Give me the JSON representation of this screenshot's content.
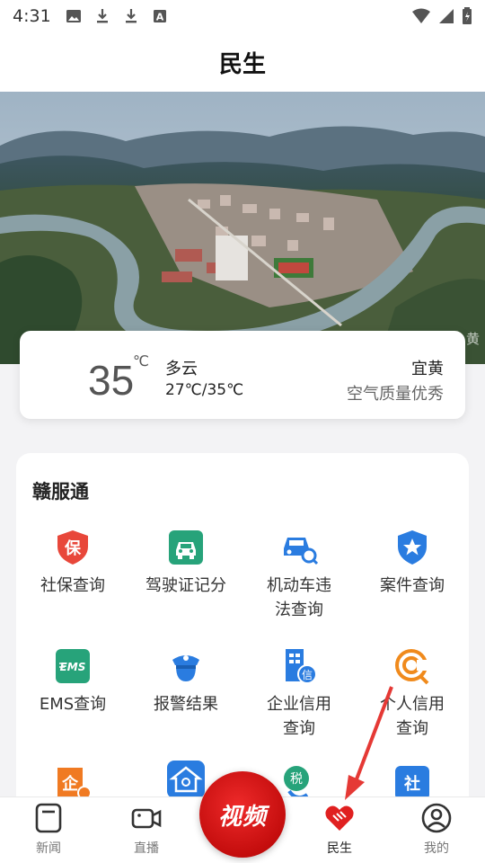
{
  "status_bar": {
    "time": "4:31"
  },
  "header": {
    "title": "民生"
  },
  "hero": {
    "watermark": "黄"
  },
  "weather": {
    "temperature": "35",
    "unit": "℃",
    "condition": "多云",
    "range": "27℃/35℃",
    "location": "宜黄",
    "air_quality": "空气质量优秀"
  },
  "services": {
    "title": "赣服通",
    "items": [
      {
        "label": "社保查询",
        "icon": "social-security-icon",
        "color": "#e8473a"
      },
      {
        "label": "驾驶证记分",
        "icon": "driver-license-icon",
        "color": "#27a37a"
      },
      {
        "label": "机动车违\n法查询",
        "icon": "vehicle-violation-icon",
        "color": "#2a7ce0"
      },
      {
        "label": "案件查询",
        "icon": "case-query-icon",
        "color": "#2a7ce0"
      },
      {
        "label": "EMS查询",
        "icon": "ems-icon",
        "color": "#27a37a"
      },
      {
        "label": "报警结果",
        "icon": "police-icon",
        "color": "#2a7ce0"
      },
      {
        "label": "企业信用\n查询",
        "icon": "enterprise-credit-icon",
        "color": "#2a7ce0"
      },
      {
        "label": "个人信用\n查询",
        "icon": "personal-credit-icon",
        "color": "#f08a1c"
      },
      {
        "label": "",
        "icon": "enterprise-icon",
        "color": "#f07a22"
      },
      {
        "label": "",
        "icon": "housing-icon",
        "color": "#2a7ce0"
      },
      {
        "label": "",
        "icon": "tax-icon",
        "color": "#27a37a"
      },
      {
        "label": "",
        "icon": "social-icon",
        "color": "#2a7ce0"
      }
    ]
  },
  "bottom_nav": {
    "items": [
      {
        "label": "新闻",
        "icon": "news-icon"
      },
      {
        "label": "直播",
        "icon": "live-icon"
      },
      {
        "label": "民生",
        "icon": "livelihood-icon"
      },
      {
        "label": "我的",
        "icon": "profile-icon"
      }
    ],
    "center_button": "视频",
    "active_index": 2
  },
  "colors": {
    "accent": "#e02020",
    "arrow": "#e53935"
  }
}
